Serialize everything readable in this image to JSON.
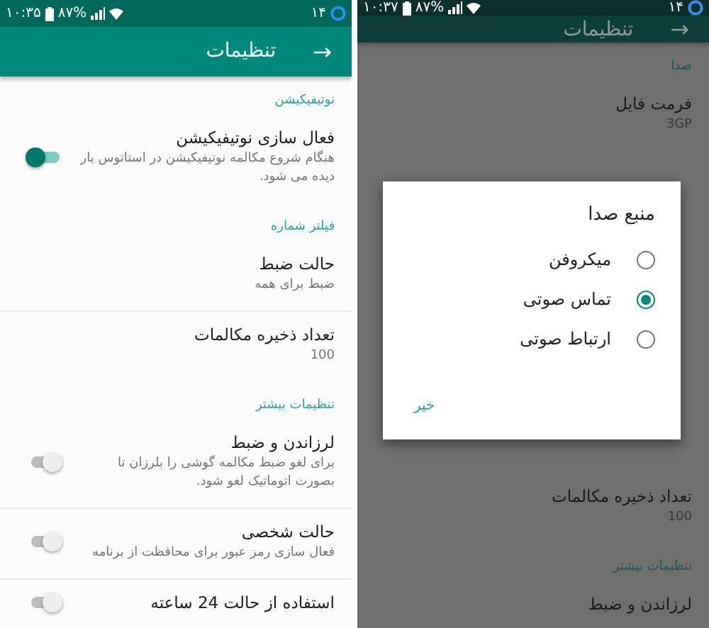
{
  "phones": [
    {
      "dimmed": true,
      "status_bar": {
        "time": "۱۰:۳۷",
        "battery": "۸۷%",
        "date": "۱۴"
      },
      "app_bar": {
        "title": "تنظیمات",
        "back": "→"
      },
      "items": [
        {
          "kind": "section",
          "title": "صدا"
        },
        {
          "kind": "setting",
          "title": "فرمت فایل",
          "summary": "3GP",
          "toggle": false,
          "divider": false
        },
        {
          "kind": "dialog",
          "title": "منبع صدا",
          "options": [
            {
              "label": "میکروفن",
              "selected": false
            },
            {
              "label": "تماس صوتی",
              "selected": true
            },
            {
              "label": "ارتباط صوتی",
              "selected": false
            }
          ],
          "button": "خیر"
        },
        {
          "kind": "setting",
          "title": "تعداد ذخیره مکالمات",
          "summary": "100",
          "toggle": false,
          "divider": false
        },
        {
          "kind": "section",
          "title": "تنظیمات بیشتر"
        },
        {
          "kind": "setting",
          "title": "لرزاندن و ضبط",
          "toggle": false,
          "divider": false
        }
      ]
    },
    {
      "dimmed": false,
      "status_bar": {
        "time": "۱۰:۳۵",
        "battery": "۸۷%",
        "date": "۱۴"
      },
      "app_bar": {
        "title": "تنظیمات",
        "back": "→"
      },
      "items": [
        {
          "kind": "section",
          "title": "نوتیفیکیشن"
        },
        {
          "kind": "setting",
          "title": "فعال سازی نوتیفیکیشن",
          "summary": "هنگام شروع مکالمه نوتیفیکیشن در استاتوس بار دیده می شود.",
          "toggle": true,
          "on": true,
          "divider": false
        },
        {
          "kind": "section",
          "title": "فیلتر شماره"
        },
        {
          "kind": "setting",
          "title": "حالت ضبط",
          "summary": "ضبط برای همه",
          "toggle": false,
          "divider": true
        },
        {
          "kind": "setting",
          "title": "تعداد ذخیره مکالمات",
          "summary": "100",
          "toggle": false,
          "divider": false
        },
        {
          "kind": "section",
          "title": "تنظیمات بیشتر"
        },
        {
          "kind": "setting",
          "title": "لرزاندن و ضبط",
          "summary": "برای لغو ضبط مکالمه گوشی را بلرزان تا بصورت اتوماتیک لغو شود.",
          "toggle": true,
          "on": false,
          "divider": true
        },
        {
          "kind": "setting",
          "title": "حالت شخصی",
          "summary": "فعال سازی رمز عبور برای محافظت از برنامه",
          "toggle": true,
          "on": false,
          "divider": true
        },
        {
          "kind": "setting",
          "title": "استفاده از حالت 24 ساعته",
          "toggle": true,
          "on": false,
          "divider": false
        }
      ]
    }
  ]
}
